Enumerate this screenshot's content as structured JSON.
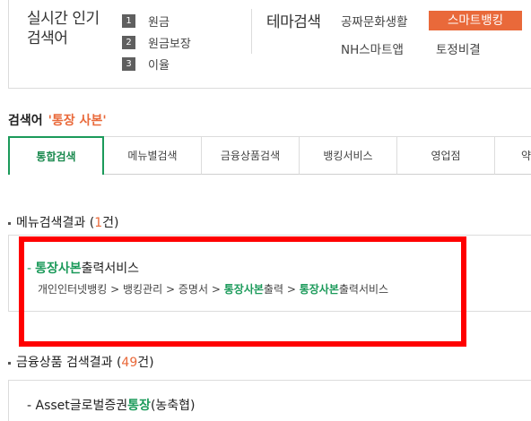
{
  "popular": {
    "title_line1": "실시간 인기",
    "title_line2": "검색어",
    "items": [
      {
        "rank": "1",
        "word": "원금"
      },
      {
        "rank": "2",
        "word": "원금보장"
      },
      {
        "rank": "3",
        "word": "이율"
      }
    ]
  },
  "theme": {
    "title": "테마검색",
    "links": [
      "공짜문화생활",
      "NH스마트앱",
      "토정비결"
    ],
    "active_button": "스마트뱅킹"
  },
  "search": {
    "label": "검색어",
    "keyword": "'통장 사본'"
  },
  "tabs": [
    "통합검색",
    "메뉴별검색",
    "금융상품검색",
    "뱅킹서비스",
    "영업점",
    "약"
  ],
  "menu_result": {
    "head_prefix": "메뉴검색결과 (",
    "count": "1",
    "head_suffix": "건)",
    "item": {
      "dash": "-",
      "highlight": "통장사본",
      "rest": "출력서비스"
    },
    "crumbs": [
      {
        "text": "개인인터넷뱅킹",
        "hl": false
      },
      {
        "text": "뱅킹관리",
        "hl": false
      },
      {
        "text": "증명서",
        "hl": false
      },
      {
        "text": "통장사본",
        "hl": true,
        "tail": "출력"
      },
      {
        "text": "통장사본",
        "hl": true,
        "tail": "출력서비스"
      }
    ],
    "sep": ">"
  },
  "product_result": {
    "head_prefix": "금융상품 검색결과 (",
    "count": "49",
    "head_suffix": "건)",
    "item": {
      "prefix": "- Asset글로벌증권",
      "highlight": "통장",
      "suffix": "(농축협)"
    }
  },
  "colors": {
    "accent_orange": "#e9693a",
    "accent_green": "#1b9a5a",
    "highlight_red": "#ff0000"
  }
}
